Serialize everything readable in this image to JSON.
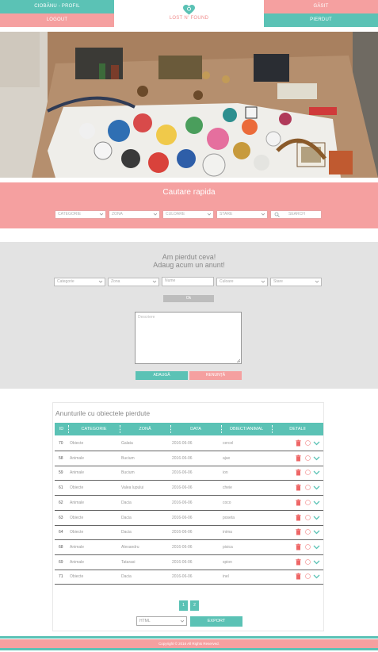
{
  "header": {
    "profile_label": "CIOBĂNU - PROFIL",
    "logout_label": "LOGOUT",
    "found_label": "GĂSIT",
    "lost_label": "PIERDUT",
    "logo_text": "LOST N' FOUND",
    "colors": {
      "teal": "#5bc2b5",
      "pink": "#f5a0a0"
    }
  },
  "hero": {
    "icon": "photo-of-lost-items"
  },
  "quick_search": {
    "title": "Cautare rapida",
    "filters": [
      "CATEGORIE",
      "ZONA",
      "CULOARE",
      "STARE"
    ],
    "search_placeholder": "SEARCH"
  },
  "add_form": {
    "title_line1": "Am pierdut ceva!",
    "title_line2": "Adaug acum un anunt!",
    "category_select": "Categorie",
    "zone_select": "Zona",
    "name_placeholder": "Nume",
    "color_select": "Culoare",
    "state_select": "Stare",
    "ok_button": "Ok",
    "description_placeholder": "Descriere",
    "add_button": "ADAUGĂ",
    "cancel_button": "RENUNȚĂ"
  },
  "table": {
    "title": "Anunturile cu obiectele pierdute",
    "columns": [
      "ID",
      "CATEGORIE",
      "ZONĂ",
      "DATA",
      "OBIECT/ANIMAL",
      "DETALII"
    ],
    "rows": [
      {
        "id": "70",
        "category": "Obiecte",
        "zone": "Galata",
        "date": "2016-06-06",
        "object": "cercel"
      },
      {
        "id": "58",
        "category": "Animale",
        "zone": "Bucium",
        "date": "2016-06-06",
        "object": "ajax"
      },
      {
        "id": "59",
        "category": "Animale",
        "zone": "Bucium",
        "date": "2016-06-06",
        "object": "ion"
      },
      {
        "id": "61",
        "category": "Obiecte",
        "zone": "Valea lupului",
        "date": "2016-06-06",
        "object": "cheie"
      },
      {
        "id": "62",
        "category": "Animale",
        "zone": "Dacia",
        "date": "2016-06-06",
        "object": "coco"
      },
      {
        "id": "63",
        "category": "Obiecte",
        "zone": "Dacia",
        "date": "2016-06-06",
        "object": "poseta"
      },
      {
        "id": "64",
        "category": "Obiecte",
        "zone": "Dacia",
        "date": "2016-06-06",
        "object": "inima"
      },
      {
        "id": "68",
        "category": "Animale",
        "zone": "Alexandru",
        "date": "2016-06-06",
        "object": "pisica"
      },
      {
        "id": "69",
        "category": "Animale",
        "zone": "Tatarasi",
        "date": "2016-06-06",
        "object": "spion"
      },
      {
        "id": "71",
        "category": "Obiecte",
        "zone": "Dacia",
        "date": "2016-06-06",
        "object": "inel"
      }
    ],
    "pages": [
      "1",
      "2"
    ],
    "format_select": "HTML",
    "export_button": "EXPORT"
  },
  "footer": {
    "copyright": "Copyright © 2016 All Rights Reserved."
  }
}
